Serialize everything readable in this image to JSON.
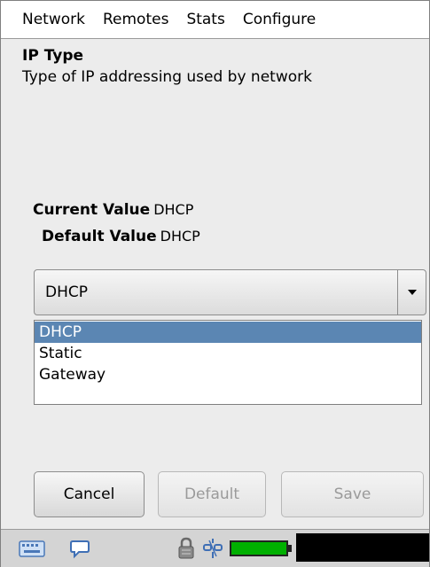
{
  "menu": {
    "items": [
      "Network",
      "Remotes",
      "Stats",
      "Configure"
    ]
  },
  "param": {
    "title": "IP Type",
    "description": "Type of IP addressing used by network"
  },
  "values": {
    "current_label": "Current Value",
    "current_value": "DHCP",
    "default_label": "Default Value",
    "default_value": "DHCP"
  },
  "combo": {
    "selected": "DHCP",
    "options": [
      "DHCP",
      "Static",
      "Gateway"
    ],
    "highlighted_index": 0
  },
  "buttons": {
    "cancel": "Cancel",
    "default": "Default",
    "save": "Save"
  },
  "statusbar": {
    "icons": [
      "keyboard-icon",
      "chat-bubble-icon",
      "lock-icon",
      "network-link-icon",
      "battery-icon"
    ],
    "battery_color": "#00b000"
  },
  "colors": {
    "selection": "#5b86b3",
    "background": "#ececec"
  }
}
